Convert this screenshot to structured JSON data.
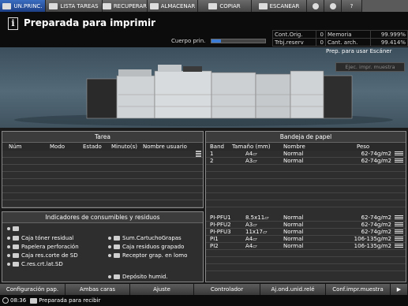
{
  "tabs": [
    {
      "name": "tab-home",
      "label": "UN.PRINC.",
      "icon": "home-icon",
      "active": true,
      "w": 58
    },
    {
      "name": "tab-job-list",
      "label": "LISTA TAREAS",
      "icon": "job-list-icon",
      "active": false,
      "w": 72
    },
    {
      "name": "tab-recall",
      "label": "RECUPERAR",
      "icon": "recall-icon",
      "active": false,
      "w": 57
    },
    {
      "name": "tab-store",
      "label": "ALMACENAR",
      "icon": "store-icon",
      "active": false,
      "w": 64
    },
    {
      "name": "tab-copy",
      "label": "COPIAR",
      "icon": "copy-icon",
      "active": false,
      "w": 68
    },
    {
      "name": "tab-scan",
      "label": "ESCANEAR",
      "icon": "scan-icon",
      "active": false,
      "w": 70
    },
    {
      "name": "tab-globe",
      "label": "",
      "icon": "globe-icon",
      "active": false,
      "w": 22
    },
    {
      "name": "tab-volume",
      "label": "",
      "icon": "speaker-icon",
      "active": false,
      "w": 22
    },
    {
      "name": "tab-help",
      "label": "?",
      "icon": "",
      "active": false,
      "w": 26
    }
  ],
  "header": {
    "status": "Preparada para imprimir",
    "body_label": "Cuerpo prin.",
    "progress_fraction": 0.18
  },
  "counters": [
    {
      "label": "Cont.Orig.",
      "value": "0",
      "label2": "Memoria",
      "value2": "99.999%"
    },
    {
      "label": "Trbj.reserv",
      "value": "0",
      "label2": "Cant. arch.",
      "value2": "99.414%"
    }
  ],
  "scanner": {
    "status": "Prep. para usar Escáner",
    "button": "Ejec. impr. muestra"
  },
  "task_panel": {
    "title": "Tarea",
    "columns": [
      "Núm",
      "Modo",
      "Estado",
      "Minuto(s)",
      "Nombre usuario"
    ]
  },
  "tray_panel": {
    "title": "Bandeja de papel",
    "columns": [
      "Band",
      "Tamaño (mm)",
      "Nombre",
      "Peso"
    ],
    "upper_rows": [
      {
        "band": "1",
        "size": "A4▱",
        "name": "Normal",
        "weight": "62-74g/m2"
      },
      {
        "band": "2",
        "size": "A3▱",
        "name": "Normal",
        "weight": "62-74g/m2"
      }
    ],
    "lower_rows": [
      {
        "band": "PI-PFU1",
        "size": "8.5x11▱",
        "name": "Normal",
        "weight": "62-74g/m2"
      },
      {
        "band": "PI-PFU2",
        "size": "A3▱",
        "name": "Normal",
        "weight": "62-74g/m2"
      },
      {
        "band": "PI-PFU3",
        "size": "11x17▱",
        "name": "Normal",
        "weight": "62-74g/m2"
      },
      {
        "band": "PI1",
        "size": "A4▱",
        "name": "Normal",
        "weight": "106-135g/m2"
      },
      {
        "band": "PI2",
        "size": "A4▱",
        "name": "Normal",
        "weight": "106-135g/m2"
      }
    ]
  },
  "consumables": {
    "title": "Indicadores de consumibles y residuos",
    "left": [
      {
        "label": "Caja tóner residual",
        "icon": "waste-toner-icon"
      },
      {
        "label": "Papelera perforación",
        "icon": "punch-waste-icon"
      },
      {
        "label": "Caja res.corte de SD",
        "icon": "trim-waste-icon"
      },
      {
        "label": "C.res.crt.lat.SD",
        "icon": "side-trim-waste-icon"
      }
    ],
    "right": [
      {
        "label": "Sum.CartuchoGrapas",
        "icon": "staple-cartridge-icon"
      },
      {
        "label": "Caja residuos grapado",
        "icon": "staple-waste-icon"
      },
      {
        "label": "Receptor grap. en lomo",
        "icon": "spine-staple-icon"
      }
    ],
    "dehumid": "Depósito humid."
  },
  "bottom_buttons": [
    {
      "name": "paper-setting-button",
      "label": "Configuración pap.",
      "w": 83
    },
    {
      "name": "duplex-button",
      "label": "Ambas caras",
      "w": 82
    },
    {
      "name": "adjustment-button",
      "label": "Ajuste",
      "w": 81
    },
    {
      "name": "controller-button",
      "label": "Controlador",
      "w": 84
    },
    {
      "name": "unit-adjust-button",
      "label": "Aj.ond.unid.relé",
      "w": 83
    },
    {
      "name": "sample-print-settings-button",
      "label": "Conf.impr.muestra",
      "w": 82
    },
    {
      "name": "next-button",
      "label": "▶",
      "w": 22
    }
  ],
  "statusbar": {
    "time": "08:36",
    "message": "Preparada para recibir"
  }
}
